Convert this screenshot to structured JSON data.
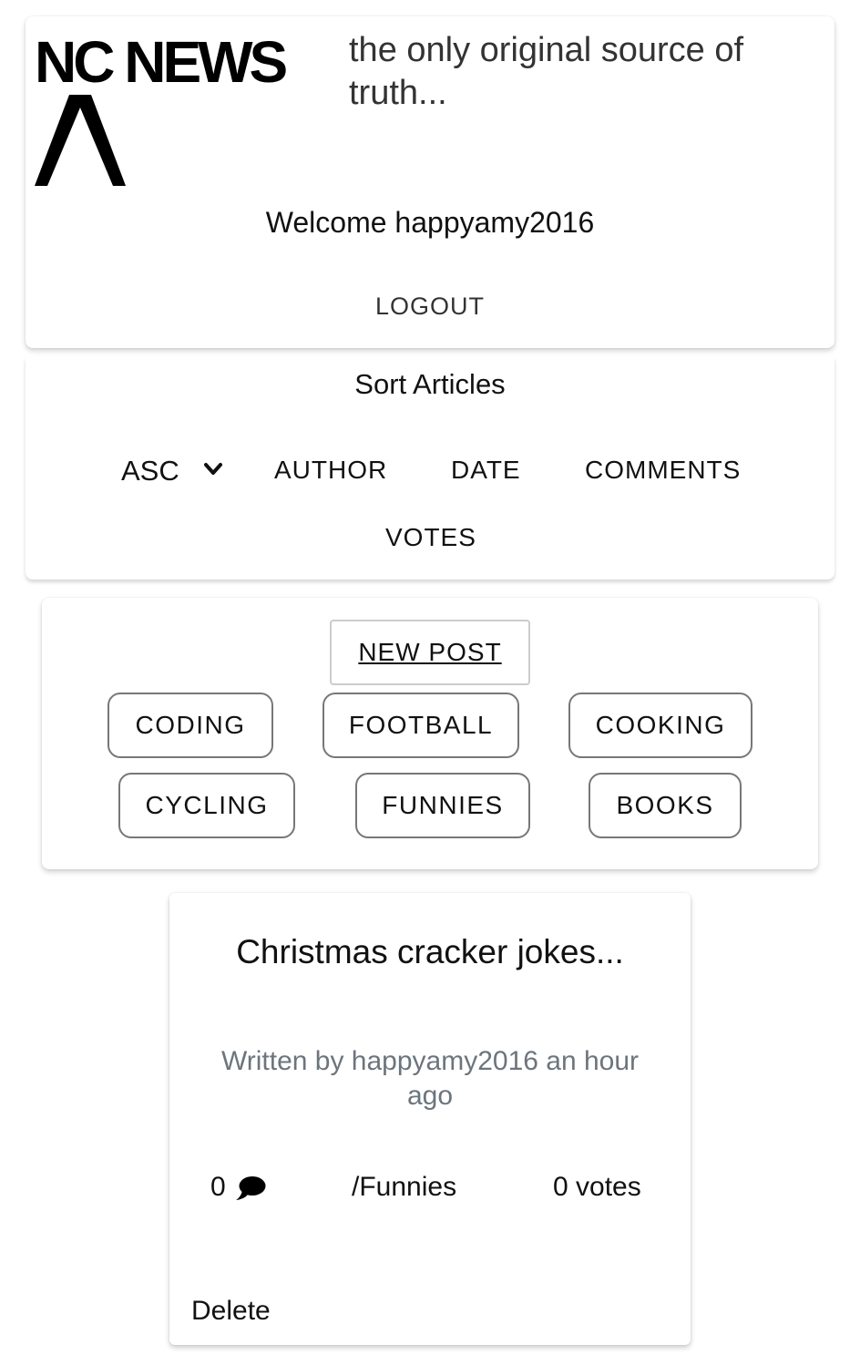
{
  "header": {
    "logo_text": "NC NEWS",
    "tagline": "the only original source of truth...",
    "welcome": "Welcome happyamy2016",
    "logout_label": "LOGOUT"
  },
  "sort": {
    "title": "Sort Articles",
    "order_value": "ASC",
    "buttons": [
      "AUTHOR",
      "DATE",
      "COMMENTS",
      "VOTES"
    ]
  },
  "topics": {
    "new_post_label": "NEW POST",
    "items": [
      "CODING",
      "FOOTBALL",
      "COOKING",
      "CYCLING",
      "FUNNIES",
      "BOOKS"
    ]
  },
  "article": {
    "title": "Christmas cracker jokes...",
    "byline": "Written by happyamy2016 an hour ago",
    "comment_count": "0",
    "topic": "/Funnies",
    "votes": "0 votes",
    "delete_label": "Delete"
  },
  "icons": {
    "logo": "caret-up-icon",
    "sort_order": "chevron-down-icon",
    "comments": "speech-bubble-icon"
  }
}
